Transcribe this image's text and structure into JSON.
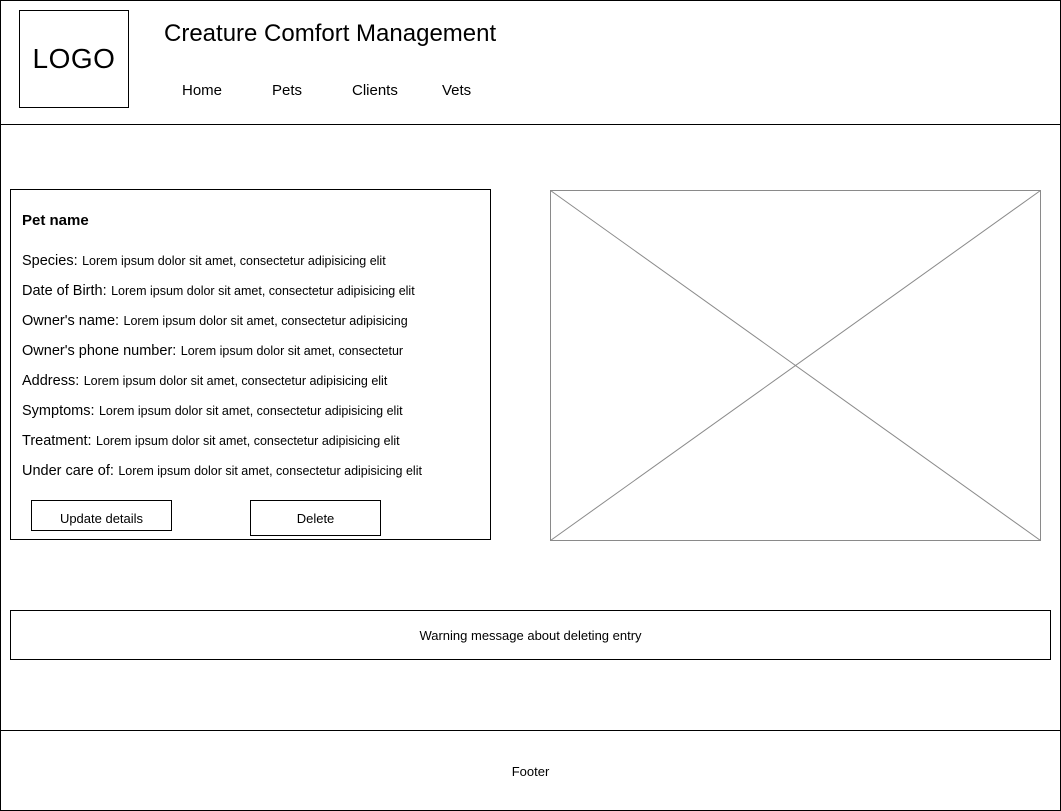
{
  "header": {
    "logo_text": "LOGO",
    "title": "Creature Comfort Management",
    "nav": [
      {
        "label": "Home"
      },
      {
        "label": "Pets"
      },
      {
        "label": "Clients"
      },
      {
        "label": "Vets"
      }
    ]
  },
  "pet": {
    "name": "Pet name",
    "details": [
      {
        "label": "Species:",
        "value": "Lorem ipsum dolor sit amet, consectetur adipisicing elit"
      },
      {
        "label": "Date of Birth:",
        "value": "Lorem ipsum dolor sit amet, consectetur adipisicing elit"
      },
      {
        "label": "Owner's name:",
        "value": "Lorem ipsum dolor sit amet, consectetur adipisicing"
      },
      {
        "label": "Owner's phone number:",
        "value": "Lorem ipsum dolor sit amet, consectetur"
      },
      {
        "label": "Address:",
        "value": "Lorem ipsum dolor sit amet, consectetur adipisicing elit"
      },
      {
        "label": "Symptoms:",
        "value": "Lorem ipsum dolor sit amet, consectetur adipisicing elit"
      },
      {
        "label": "Treatment:",
        "value": "Lorem ipsum dolor sit amet, consectetur adipisicing elit"
      },
      {
        "label": "Under care of:",
        "value": "Lorem ipsum dolor sit amet, consectetur adipisicing elit"
      }
    ],
    "actions": {
      "update_label": "Update details",
      "delete_label": "Delete"
    }
  },
  "image": {
    "icon": "image-placeholder-icon"
  },
  "warning": {
    "message": "Warning message about deleting entry"
  },
  "footer": {
    "text": "Footer"
  }
}
